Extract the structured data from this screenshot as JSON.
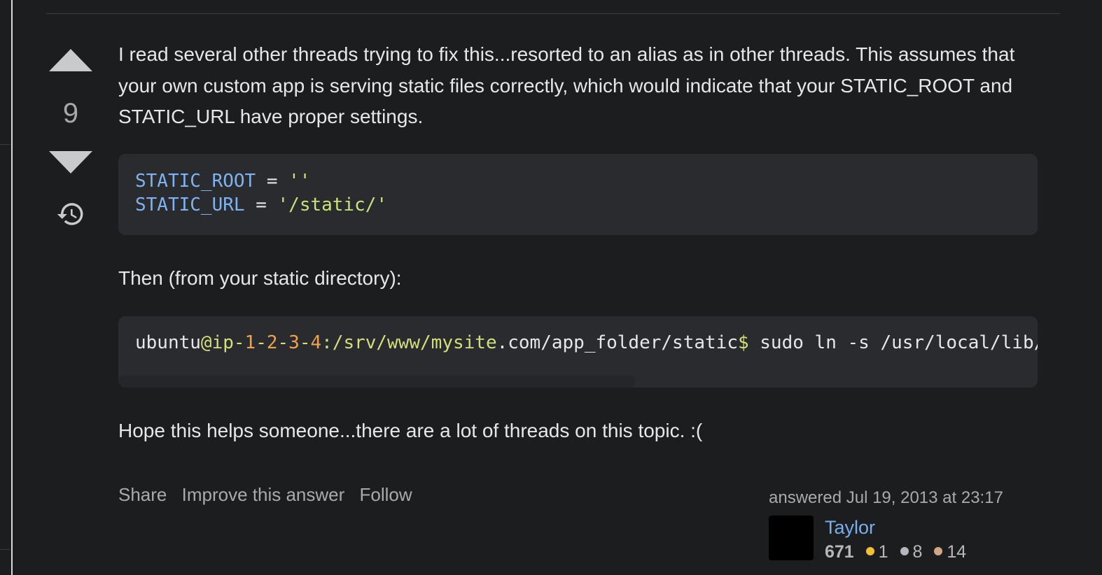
{
  "vote": {
    "score": "9"
  },
  "answer": {
    "paragraph1": "I read several other threads trying to fix this...resorted to an alias as in other threads. This assumes that your own custom app is serving static files correctly, which would indicate that your STATIC_ROOT and STATIC_URL have proper settings.",
    "code1": {
      "line1_var": "STATIC_ROOT",
      "line1_op": " = ",
      "line1_str": "''",
      "line2_var": "STATIC_URL",
      "line2_op": " = ",
      "line2_str": "'/static/'"
    },
    "paragraph2": "Then (from your static directory):",
    "code2": {
      "part1": "ubuntu",
      "part2": "@ip-",
      "part3": "1",
      "part4": "-",
      "part5": "2",
      "part6": "-",
      "part7": "3",
      "part8": "-",
      "part9": "4",
      "part10": ":/srv/www/mysite",
      "part11": ".com/app_folder/static",
      "part12": "$",
      "part13": " sudo ln -s /usr/local/lib/"
    },
    "paragraph3": "Hope this helps someone...there are a lot of threads on this topic. :("
  },
  "actions": {
    "share": "Share",
    "improve": "Improve this answer",
    "follow": "Follow"
  },
  "signature": {
    "answered": "answered Jul 19, 2013 at 23:17",
    "user_name": "Taylor",
    "reputation": "671",
    "badges": [
      {
        "count": "1",
        "color": "#f4c033"
      },
      {
        "count": "8",
        "color": "#b4b8bc"
      },
      {
        "count": "14",
        "color": "#d1a684"
      }
    ]
  }
}
